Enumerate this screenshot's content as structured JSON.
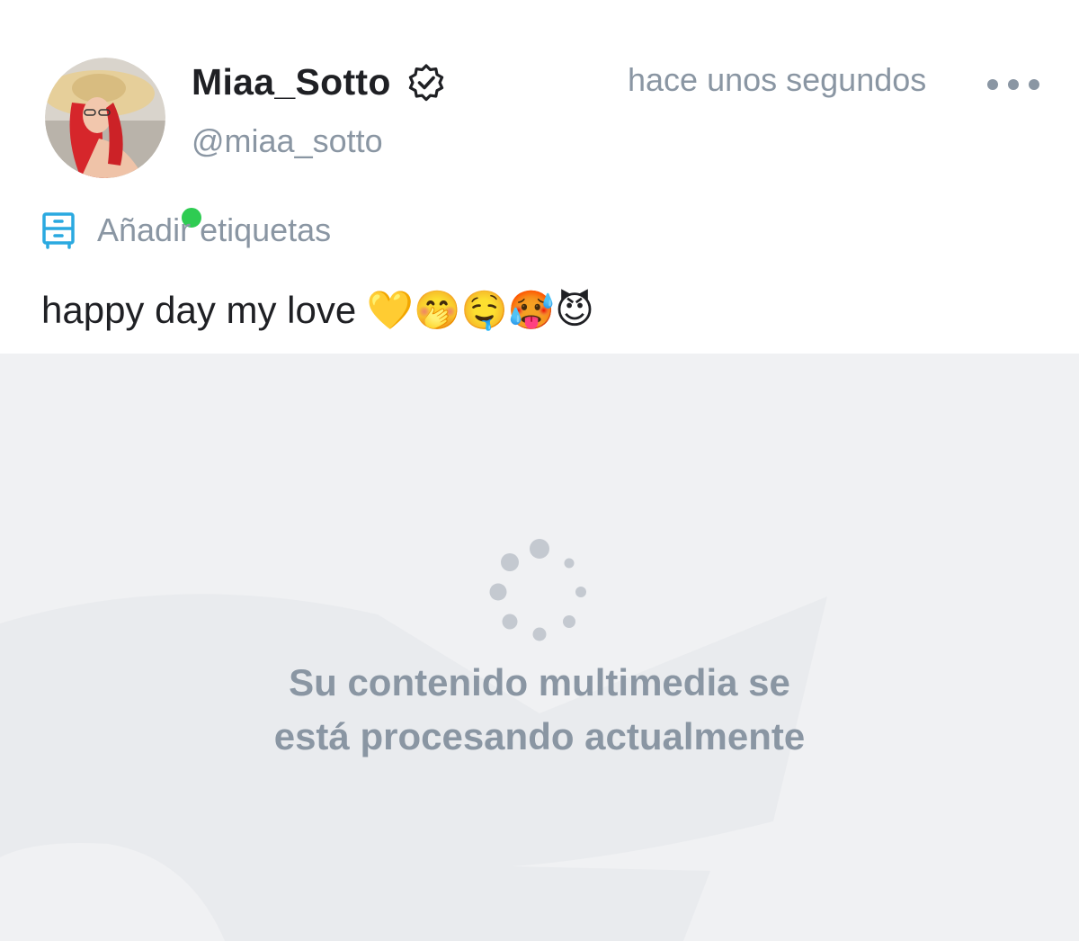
{
  "post": {
    "author": {
      "display_name": "Miaa_Sotto",
      "handle": "@miaa_sotto",
      "verified_icon": "verified-badge-icon",
      "online": true,
      "online_color": "#2ecc52"
    },
    "timestamp": "hace unos segundos",
    "more_icon": "more-horizontal-icon",
    "tags": {
      "icon": "tag-drawer-icon",
      "label": "Añadir etiquetas",
      "icon_color": "#2aa9e0"
    },
    "caption": {
      "text": "happy day my love",
      "emojis": [
        "💛",
        "🤭",
        "🤤",
        "🥵",
        "😈"
      ]
    }
  },
  "media": {
    "spinner_icon": "loading-spinner-icon",
    "message_line1": "Su contenido multimedia se",
    "message_line2": "está procesando actualmente",
    "background_color": "#f0f1f3"
  },
  "colors": {
    "text_primary": "#1f2024",
    "text_secondary": "#8a96a3"
  }
}
